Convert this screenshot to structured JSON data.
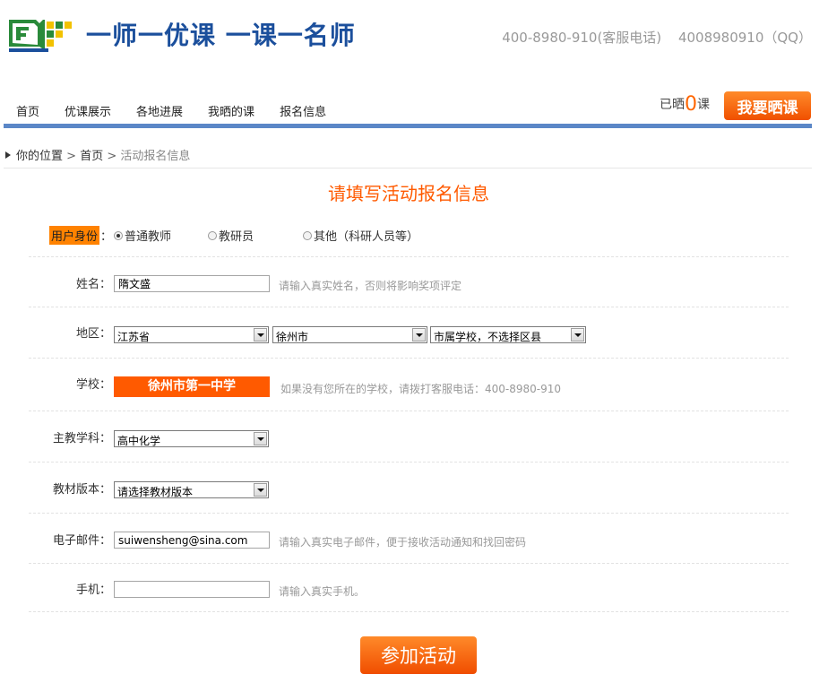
{
  "header": {
    "slogan": "一师一优课 一课一名师",
    "service_phone": "400-8980-910(客服电话)",
    "qq": "4008980910（QQ）"
  },
  "nav": {
    "items": [
      "首页",
      "优课展示",
      "各地进展",
      "我晒的课",
      "报名信息"
    ],
    "shai_prefix": "已晒",
    "shai_count": "0",
    "shai_suffix": "课",
    "shai_button": "我要晒课"
  },
  "breadcrumb": {
    "position_label": "你的位置",
    "home": "首页",
    "sep": ">",
    "current": "活动报名信息"
  },
  "form": {
    "title": "请填写活动报名信息",
    "identity": {
      "label": "用户身份",
      "colon": "：",
      "options": [
        "普通教师",
        "教研员",
        "其他（科研人员等）"
      ],
      "selected_index": 0
    },
    "name": {
      "label": "姓名：",
      "value": "隋文盛",
      "hint": "请输入真实姓名，否则将影响奖项评定"
    },
    "region": {
      "label": "地区：",
      "province": "江苏省",
      "city": "徐州市",
      "district": "市属学校，不选择区县"
    },
    "school": {
      "label": "学校：",
      "value": "徐州市第一中学",
      "hint": "如果没有您所在的学校，请拨打客服电话：400-8980-910"
    },
    "subject": {
      "label": "主教学科：",
      "value": "高中化学"
    },
    "textbook": {
      "label": "教材版本：",
      "value": "请选择教材版本"
    },
    "email": {
      "label": "电子邮件：",
      "value": "suiwensheng@sina.com",
      "hint": "请输入真实电子邮件，便于接收活动通知和找回密码"
    },
    "phone": {
      "label": "手机：",
      "value": "",
      "hint": "请输入真实手机。"
    },
    "submit": "参加活动"
  },
  "colors": {
    "accent": "#ff5a00",
    "brand_blue": "#1b4f9c",
    "nav_bar": "#5b87c7"
  }
}
